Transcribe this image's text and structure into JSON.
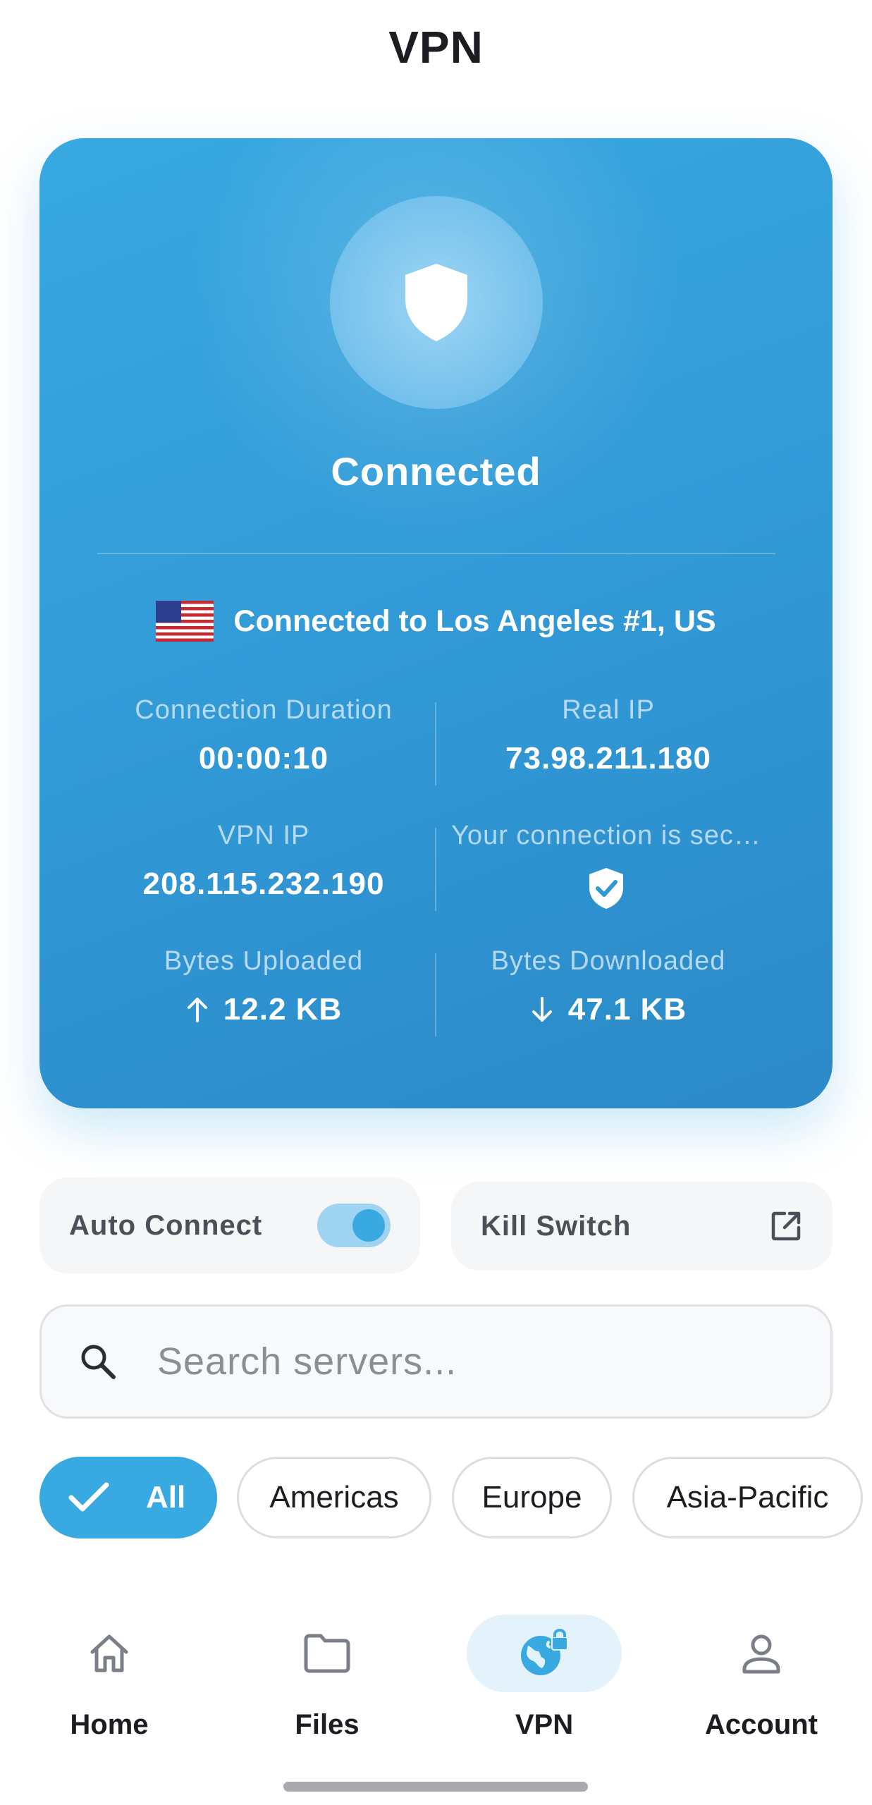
{
  "header": {
    "title": "VPN"
  },
  "status_card": {
    "status": "Connected",
    "server": "Connected to Los Angeles #1, US",
    "flag_icon": "us-flag-icon",
    "shield_icon": "shield-icon",
    "stats": {
      "duration_label": "Connection Duration",
      "duration_value": "00:00:10",
      "real_ip_label": "Real IP",
      "real_ip_value": "73.98.211.180",
      "vpn_ip_label": "VPN IP",
      "vpn_ip_value": "208.115.232.190",
      "secure_label": "Your connection is sec…",
      "uploaded_label": "Bytes Uploaded",
      "uploaded_value": "12.2 KB",
      "downloaded_label": "Bytes Downloaded",
      "downloaded_value": "47.1 KB"
    },
    "colors": {
      "card": "#38a9e1",
      "text": "#ffffff"
    }
  },
  "options": {
    "auto_connect_label": "Auto Connect",
    "auto_connect_on": true,
    "kill_switch_label": "Kill Switch"
  },
  "search": {
    "placeholder": "Search servers..."
  },
  "filters": {
    "all": "All",
    "americas": "Americas",
    "europe": "Europe",
    "asia_pacific": "Asia-Pacific",
    "selected": "All"
  },
  "nav": {
    "home": "Home",
    "files": "Files",
    "vpn": "VPN",
    "account": "Account",
    "active": "VPN"
  },
  "colors": {
    "accent": "#38a9e1",
    "text": "#1c1d22",
    "muted": "#8a8e95"
  }
}
